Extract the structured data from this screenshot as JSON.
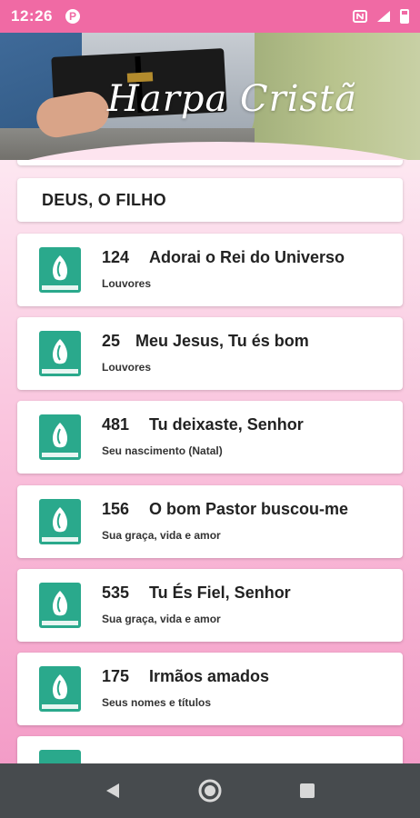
{
  "status": {
    "time": "12:26",
    "notification_glyph": "P"
  },
  "header": {
    "title": "Harpa Cristã"
  },
  "section": {
    "label": "DEUS, O FILHO"
  },
  "hymns": [
    {
      "number": "124",
      "title": "Adorai o Rei do Universo",
      "category": "Louvores"
    },
    {
      "number": "25",
      "title": "Meu Jesus, Tu és bom",
      "category": "Louvores"
    },
    {
      "number": "481",
      "title": "Tu deixaste, Senhor",
      "category": "Seu nascimento (Natal)"
    },
    {
      "number": "156",
      "title": "O bom Pastor buscou-me",
      "category": "Sua graça, vida e amor"
    },
    {
      "number": "535",
      "title": "Tu És Fiel, Senhor",
      "category": "Sua graça, vida e amor"
    },
    {
      "number": "175",
      "title": "Irmãos amados",
      "category": "Seus nomes e títulos"
    }
  ],
  "colors": {
    "status_bar": "#f06aa4",
    "icon_green": "#2aa98c",
    "nav_bar": "#474b4e"
  },
  "icons": {
    "hymn": "hymnal-book-icon",
    "back": "back-triangle-icon",
    "home": "home-circle-icon",
    "recents": "recents-square-icon"
  }
}
